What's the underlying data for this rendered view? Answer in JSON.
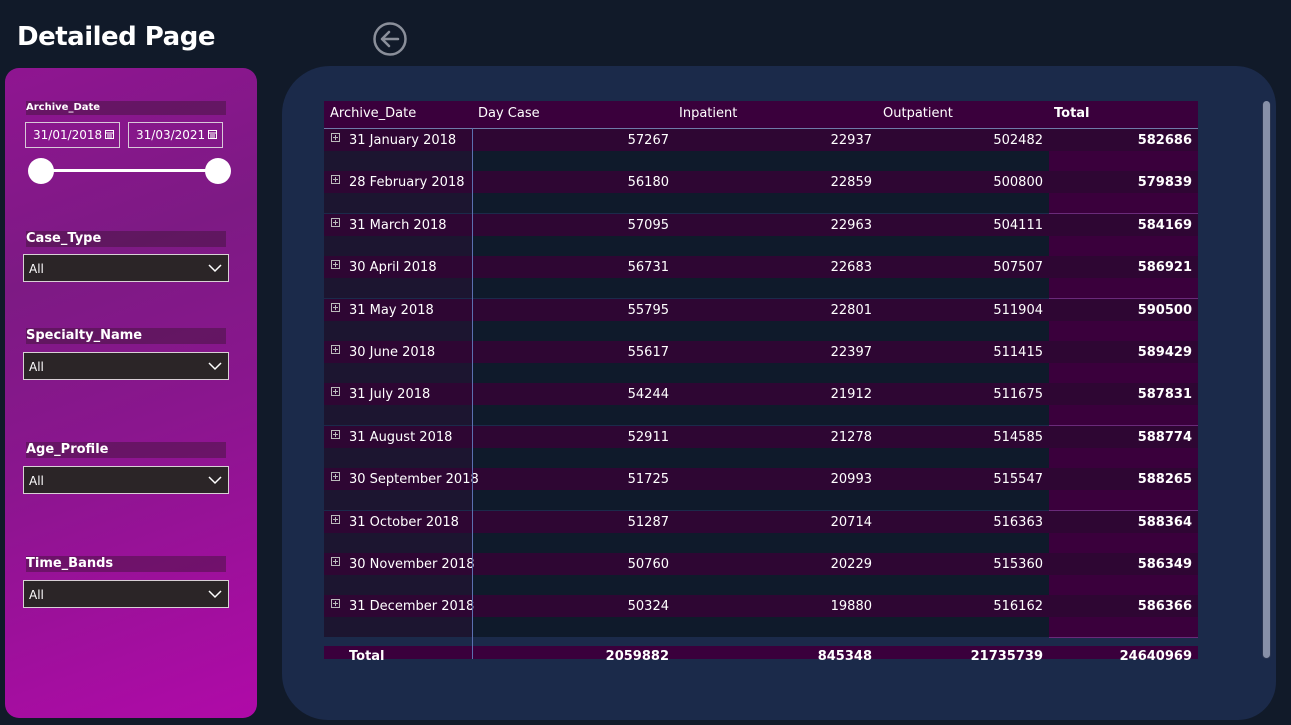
{
  "page": {
    "title": "Detailed Page"
  },
  "filters": {
    "archive_date": {
      "label": "Archive_Date",
      "start": "31/01/2018",
      "end": "31/03/2021"
    },
    "case_type": {
      "label": "Case_Type",
      "value": "All"
    },
    "specialty_name": {
      "label": "Specialty_Name",
      "value": "All"
    },
    "age_profile": {
      "label": "Age_Profile",
      "value": "All"
    },
    "time_bands": {
      "label": "Time_Bands",
      "value": "All"
    }
  },
  "table": {
    "columns": [
      "Archive_Date",
      "Day Case",
      "Inpatient",
      "Outpatient",
      "Total"
    ],
    "rows": [
      {
        "date": "31 January 2018",
        "day_case": "57267",
        "inpatient": "22937",
        "outpatient": "502482",
        "total": "582686"
      },
      {
        "date": "28 February 2018",
        "day_case": "56180",
        "inpatient": "22859",
        "outpatient": "500800",
        "total": "579839"
      },
      {
        "date": "31 March 2018",
        "day_case": "57095",
        "inpatient": "22963",
        "outpatient": "504111",
        "total": "584169"
      },
      {
        "date": "30 April 2018",
        "day_case": "56731",
        "inpatient": "22683",
        "outpatient": "507507",
        "total": "586921"
      },
      {
        "date": "31 May 2018",
        "day_case": "55795",
        "inpatient": "22801",
        "outpatient": "511904",
        "total": "590500"
      },
      {
        "date": "30 June 2018",
        "day_case": "55617",
        "inpatient": "22397",
        "outpatient": "511415",
        "total": "589429"
      },
      {
        "date": "31 July 2018",
        "day_case": "54244",
        "inpatient": "21912",
        "outpatient": "511675",
        "total": "587831"
      },
      {
        "date": "31 August 2018",
        "day_case": "52911",
        "inpatient": "21278",
        "outpatient": "514585",
        "total": "588774"
      },
      {
        "date": "30 September 2018",
        "day_case": "51725",
        "inpatient": "20993",
        "outpatient": "515547",
        "total": "588265"
      },
      {
        "date": "31 October 2018",
        "day_case": "51287",
        "inpatient": "20714",
        "outpatient": "516363",
        "total": "588364"
      },
      {
        "date": "30 November 2018",
        "day_case": "50760",
        "inpatient": "20229",
        "outpatient": "515360",
        "total": "586349"
      },
      {
        "date": "31 December 2018",
        "day_case": "50324",
        "inpatient": "19880",
        "outpatient": "516162",
        "total": "586366"
      }
    ],
    "total_row": {
      "label": "Total",
      "day_case": "2059882",
      "inpatient": "845348",
      "outpatient": "21735739",
      "total": "24640969"
    }
  },
  "colors": {
    "background": "#111a29",
    "panel_purple": "#8f1591",
    "table_panel": "#1b2a4a",
    "row_purple": "#2e0633",
    "row_dark": "#0f1a2b",
    "total_column": "#3a003c",
    "divider": "#6a2a7a"
  },
  "icons": {
    "back": "back-arrow-icon",
    "expand": "expand-plus-icon",
    "calendar": "calendar-icon",
    "dropdown": "chevron-down-icon"
  }
}
